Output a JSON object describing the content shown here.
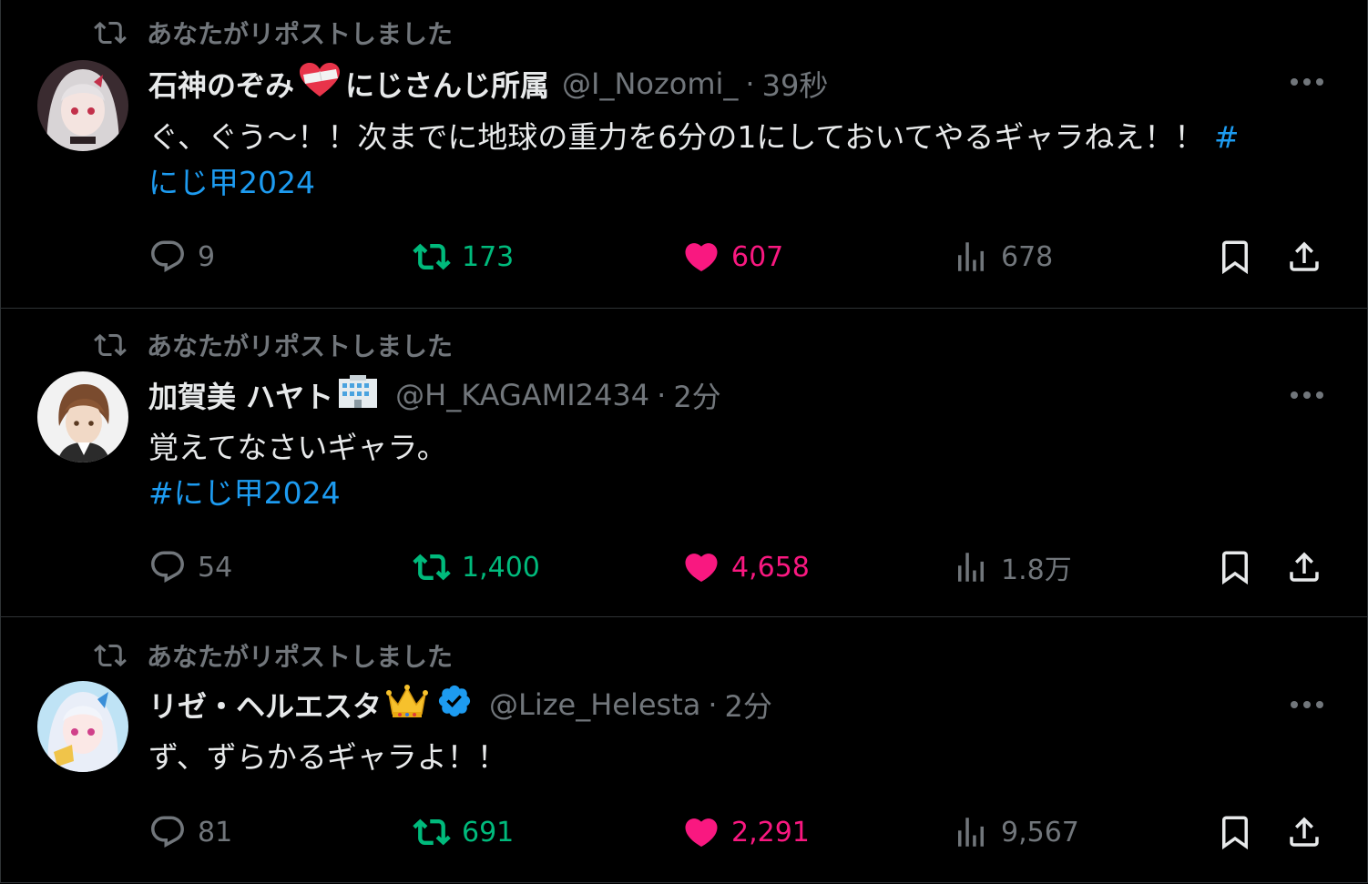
{
  "repost_notice": "あなたがリポストしました",
  "tweets": [
    {
      "name": "石神のぞみ",
      "name_suffix": "にじさんじ所属",
      "handle": "@I_Nozomi_",
      "dot": "·",
      "time": "39秒",
      "text": "ぐ、ぐう～！！次までに地球の重力を6分の1にしておいてやるギャラねえ！！ ",
      "hashtag": "#にじ甲2024",
      "replies": "9",
      "reposts": "173",
      "likes": "607",
      "views": "678",
      "avatar_colors": {
        "bg": "#3a2b30",
        "hair": "#d8d4d6",
        "accent": "#c2304a"
      }
    },
    {
      "name": "加賀美 ハヤト",
      "name_suffix": "",
      "handle": "@H_KAGAMI2434",
      "dot": "·",
      "time": "2分",
      "text": "覚えてなさいギャラ。",
      "hashtag": "#にじ甲2024",
      "replies": "54",
      "reposts": "1,400",
      "likes": "4,658",
      "views": "1.8万",
      "avatar_colors": {
        "bg": "#f2f2f2",
        "hair": "#7a4b2e",
        "accent": "#2b2b2b"
      }
    },
    {
      "name": "リゼ・ヘルエスタ",
      "name_suffix": "",
      "handle": "@Lize_Helesta",
      "dot": "·",
      "time": "2分",
      "text": "ず、ずらかるギャラよ！！",
      "hashtag": "",
      "replies": "81",
      "reposts": "691",
      "likes": "2,291",
      "views": "9,567",
      "avatar_colors": {
        "bg": "#bfe3f5",
        "hair": "#e9eef8",
        "accent": "#3a8fd8"
      }
    }
  ],
  "colors": {
    "background": "#000000",
    "text_primary": "#e7e9ea",
    "text_secondary": "#71767b",
    "hashtag": "#1d9bf0",
    "repost": "#00ba7c",
    "like": "#f91880",
    "verified": "#1d9bf0"
  },
  "icons": [
    "repost-icon",
    "reply-icon",
    "heart-icon",
    "views-icon",
    "bookmark-icon",
    "share-icon",
    "more-icon",
    "verified-badge-icon",
    "heart-bandage-emoji",
    "office-building-emoji",
    "crown-emoji"
  ]
}
